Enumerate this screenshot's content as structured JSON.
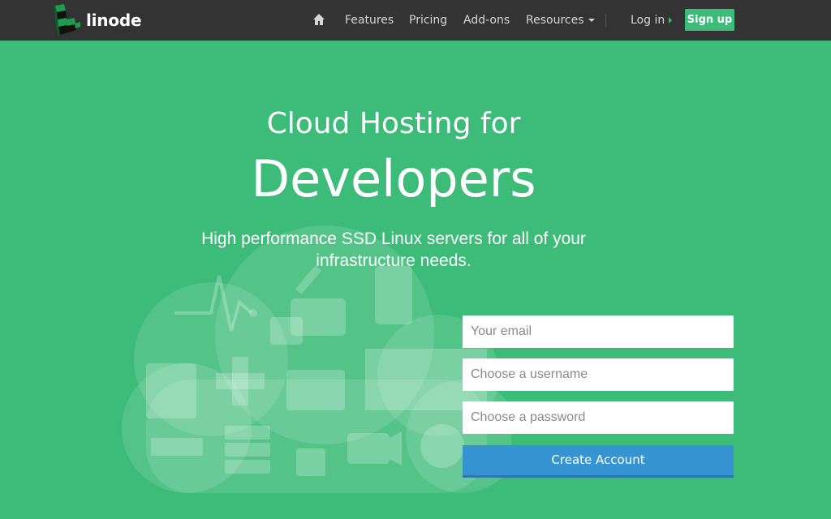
{
  "brand": {
    "name": "linode"
  },
  "nav": {
    "items": [
      {
        "label": "Features"
      },
      {
        "label": "Pricing"
      },
      {
        "label": "Add-ons"
      },
      {
        "label": "Resources"
      }
    ],
    "login_label": "Log in",
    "signup_label": "Sign up"
  },
  "hero": {
    "title_line1": "Cloud Hosting for",
    "title_line2": "Developers",
    "subtitle_line1": "High performance SSD Linux servers for all of your",
    "subtitle_line2": "infrastructure needs."
  },
  "form": {
    "email_placeholder": "Your email",
    "username_placeholder": "Choose a username",
    "password_placeholder": "Choose a password",
    "submit_label": "Create Account"
  },
  "colors": {
    "background": "#3dbb78",
    "nav_background": "#333333",
    "accent_green": "#3dbb78",
    "button_blue": "#3794d3"
  }
}
